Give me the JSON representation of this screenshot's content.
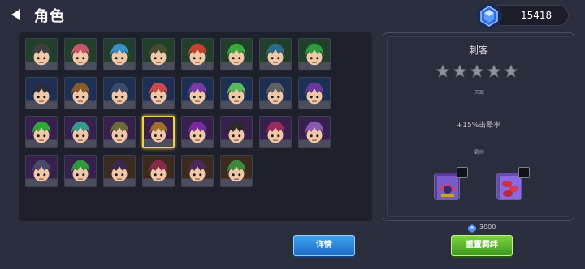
{
  "header": {
    "title": "角色",
    "gems": "15418"
  },
  "roster": {
    "selected_index": 19,
    "heroes": [
      {
        "hair": "#3e3e3e",
        "frame": "#223f2b"
      },
      {
        "hair": "#c8566a",
        "frame": "#223f2b"
      },
      {
        "hair": "#3a8ec8",
        "frame": "#223f2b"
      },
      {
        "hair": "#4a4a30",
        "frame": "#223f2b"
      },
      {
        "hair": "#c84030",
        "frame": "#223f2b"
      },
      {
        "hair": "#3aa83a",
        "frame": "#223f2b"
      },
      {
        "hair": "#2e6a8a",
        "frame": "#223f2b"
      },
      {
        "hair": "#2e9a3a",
        "frame": "#223f2b"
      },
      {
        "hair": "#2a2a3a",
        "frame": "#1d2f52"
      },
      {
        "hair": "#8a5a2a",
        "frame": "#1d2f52"
      },
      {
        "hair": "#3a4a6a",
        "frame": "#1d2f52"
      },
      {
        "hair": "#c84a4a",
        "frame": "#1d2f52"
      },
      {
        "hair": "#7a3aa8",
        "frame": "#1d2f52"
      },
      {
        "hair": "#5ab85a",
        "frame": "#1d2f52"
      },
      {
        "hair": "#606060",
        "frame": "#1d2f52"
      },
      {
        "hair": "#6a3a9a",
        "frame": "#1d2f52"
      },
      {
        "hair": "#2ea83a",
        "frame": "#38204e"
      },
      {
        "hair": "#3a9a8a",
        "frame": "#38204e"
      },
      {
        "hair": "#6a6a3a",
        "frame": "#38204e"
      },
      {
        "hair": "#a0702a",
        "frame": "#38204e"
      },
      {
        "hair": "#7a2aa0",
        "frame": "#38204e"
      },
      {
        "hair": "#2a2a2a",
        "frame": "#38204e"
      },
      {
        "hair": "#9a2a5a",
        "frame": "#38204e"
      },
      {
        "hair": "#8a5ab0",
        "frame": "#38204e"
      },
      {
        "hair": "#4a4a6a",
        "frame": "#38204e"
      },
      {
        "hair": "#2e9a3a",
        "frame": "#38204e"
      },
      {
        "hair": "#3a2a4a",
        "frame": "#3d2a1e"
      },
      {
        "hair": "#8a2a4a",
        "frame": "#3d2a1e"
      },
      {
        "hair": "#4a2a5a",
        "frame": "#3d2a1e"
      },
      {
        "hair": "#3a8a3a",
        "frame": "#3d2a1e"
      }
    ]
  },
  "detail": {
    "class_name": "刺客",
    "stars_total": 5,
    "stars_filled": 0,
    "talent_label": "天赋",
    "bonus_text": "+15%击晕率",
    "bond_label": "羁绊",
    "bond_icons": [
      "bond-card-purple-icon",
      "bond-card-red-icon"
    ]
  },
  "footer": {
    "details_button": "详情",
    "reset_cost": "3000",
    "reset_button": "重置羁绊"
  }
}
